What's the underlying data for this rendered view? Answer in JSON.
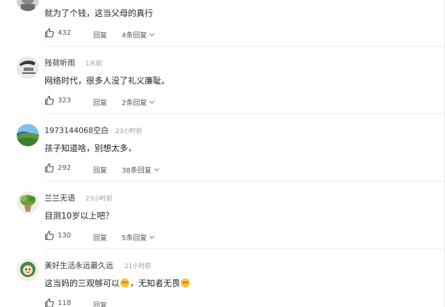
{
  "comments": [
    {
      "username": "",
      "time": "",
      "text": "就为了个钱，这当父母的真行",
      "likes": "432",
      "reply_label": "回复",
      "replies_label": "4条回复",
      "avatar_icon": "user-avatar-partial"
    },
    {
      "username": "残荷听雨",
      "time": "1天前",
      "text": "网络时代，很多人没了礼义廉耻。",
      "likes": "323",
      "reply_label": "回复",
      "replies_label": "2条回复",
      "avatar_icon": "rain-lotus-avatar"
    },
    {
      "username": "1973144068空白",
      "time": "23小时前",
      "text": "孩子知道啥，别想太多，",
      "likes": "292",
      "reply_label": "回复",
      "replies_label": "38条回复",
      "avatar_icon": "landscape-avatar"
    },
    {
      "username": "兰兰无语",
      "time": "23小时前",
      "text": "目测10岁以上吧？",
      "likes": "130",
      "reply_label": "回复",
      "replies_label": "5条回复",
      "avatar_icon": "plant-avatar"
    },
    {
      "username": "美好生活永远最久远",
      "time": "21小时前",
      "text_part1": "这当妈的三观够可以",
      "text_part2": "，无知者无畏",
      "emoji_icon": "angry-face-emoji",
      "likes": "118",
      "reply_label": "回复",
      "avatar_icon": "cartoon-avatar"
    }
  ],
  "colors": {
    "username": "#333333",
    "time": "#999999",
    "text": "#222222",
    "divider": "#ebebeb"
  }
}
